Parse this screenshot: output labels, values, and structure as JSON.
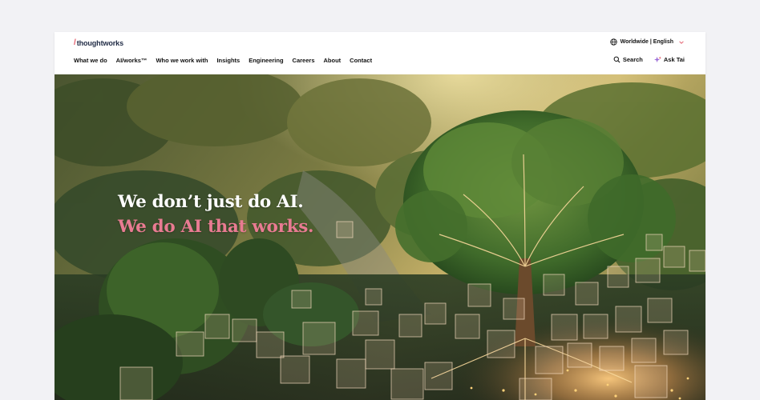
{
  "brand": {
    "slash": "/",
    "name": "thoughtworks",
    "accent": "#e45b6a"
  },
  "locale": {
    "label": "Worldwide | English",
    "icon": "globe-icon",
    "chevron": "chevron-down-icon"
  },
  "nav": {
    "items": [
      {
        "label": "What we do"
      },
      {
        "label": "AI/works™"
      },
      {
        "label": "Who we work with"
      },
      {
        "label": "Insights"
      },
      {
        "label": "Engineering"
      },
      {
        "label": "Careers"
      },
      {
        "label": "About"
      },
      {
        "label": "Contact"
      }
    ]
  },
  "tools": {
    "search_label": "Search",
    "search_icon": "search-icon",
    "ask_label": "Ask Tai",
    "ask_icon": "sparkle-icon"
  },
  "hero": {
    "line1": "We don’t just do AI.",
    "line2": "We do AI that works.",
    "line1_color": "#ffffff",
    "line2_color": "#e97b92"
  }
}
